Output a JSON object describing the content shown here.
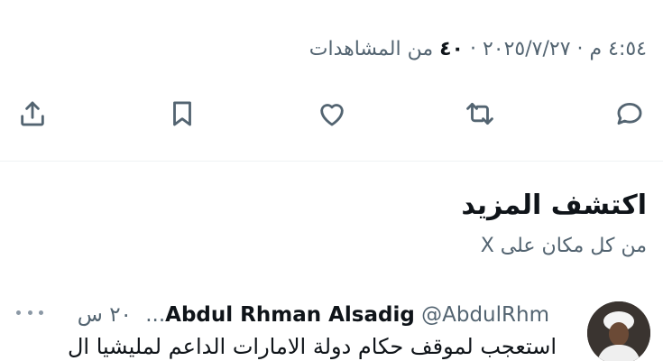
{
  "tweet_meta": {
    "datetime": "٤:٥٤ م · ٢٠٢٥/٧/٢٧ ·",
    "views_count": "٤٠",
    "views_label": "من المشاهدات"
  },
  "colors": {
    "text_primary": "#0f1419",
    "text_secondary": "#536471",
    "icon": "#536471",
    "divider": "#eff3f4"
  },
  "actions": [
    {
      "name": "reply",
      "icon": "reply-icon"
    },
    {
      "name": "retweet",
      "icon": "retweet-icon"
    },
    {
      "name": "like",
      "icon": "heart-icon"
    },
    {
      "name": "bookmark",
      "icon": "bookmark-icon"
    },
    {
      "name": "share",
      "icon": "share-icon"
    }
  ],
  "discover": {
    "title": "اكتشف المزيد",
    "subtitle": "من كل مكان على X"
  },
  "recommended_tweet": {
    "display_name": "Abdul Rhman Alsadig",
    "handle": "@AbdulRhm...",
    "time": "٢٠ س",
    "text": "استعجب لموقف حكام دولة الامارات الداعم لمليشيا ال"
  }
}
